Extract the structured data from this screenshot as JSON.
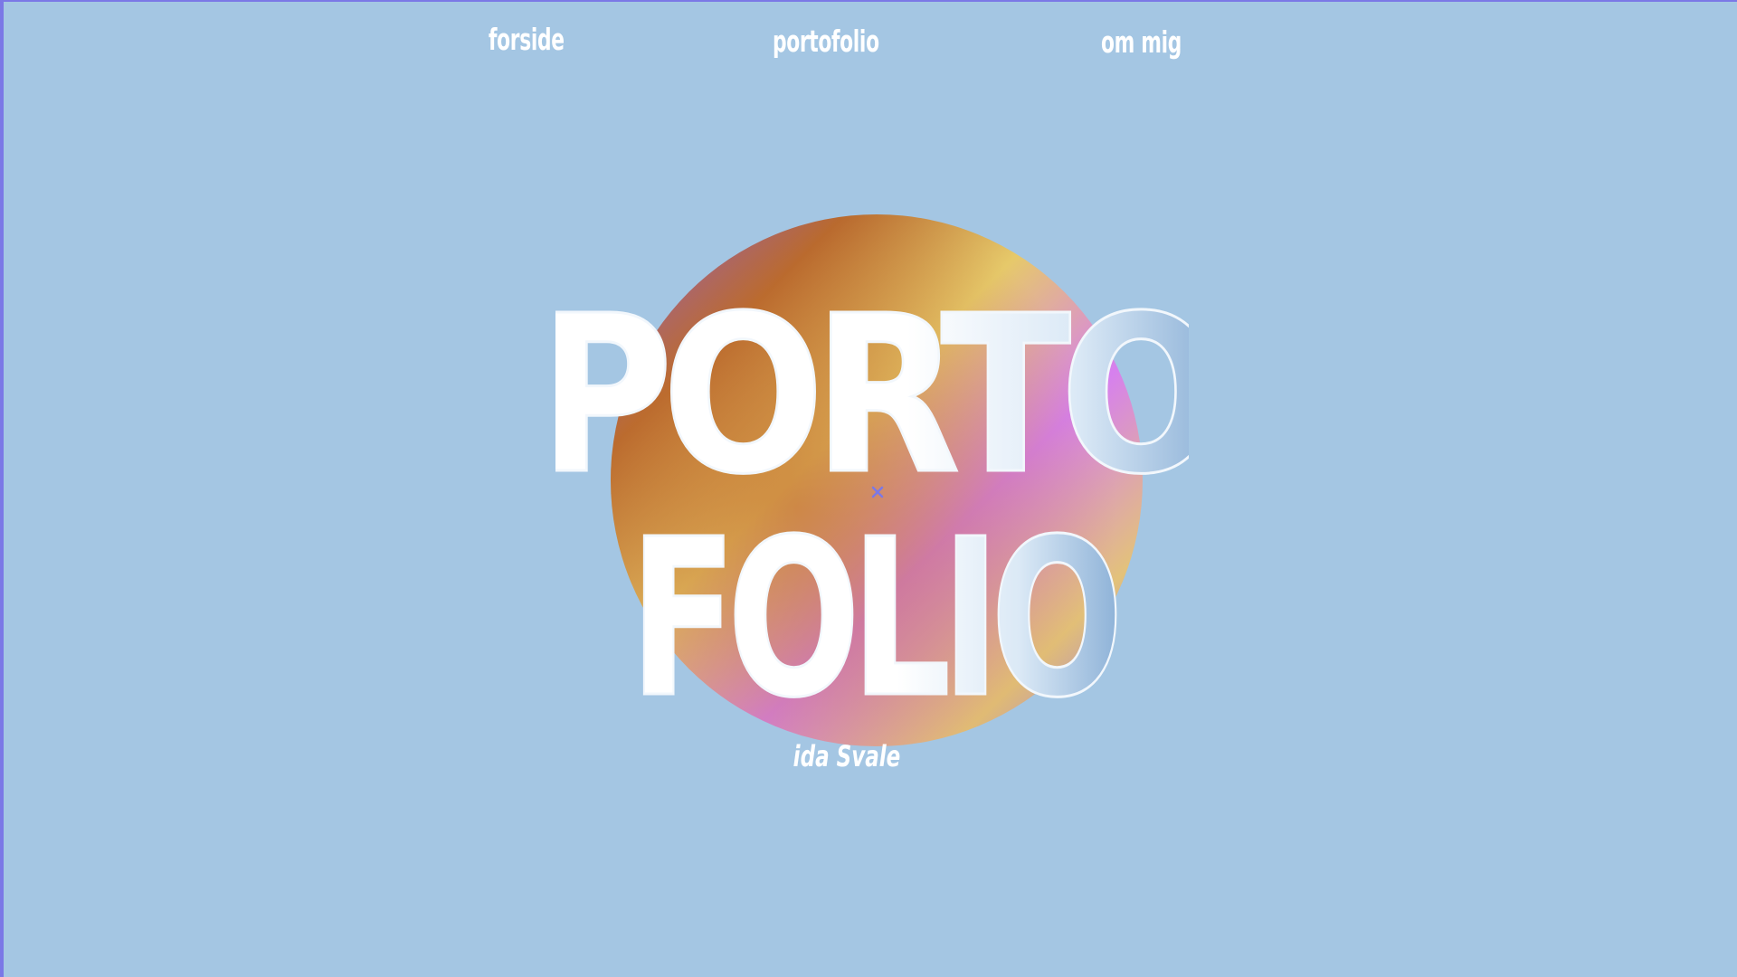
{
  "nav": {
    "home_label": "forside",
    "portfolio_label": "portofolio",
    "about_label": "om mig"
  },
  "hero": {
    "title_line1": "PORTO",
    "title_line2": "FOLIO",
    "author": "ida Svale"
  },
  "colors": {
    "background": "#a4c6e3",
    "frame": "#7b78e6",
    "text": "#ffffff",
    "gradient": [
      "#8a5cf0",
      "#b8692e",
      "#e6c96a",
      "#d680ee",
      "#8d5cf0"
    ]
  },
  "icons": {
    "cursor": "close-cross-icon"
  }
}
